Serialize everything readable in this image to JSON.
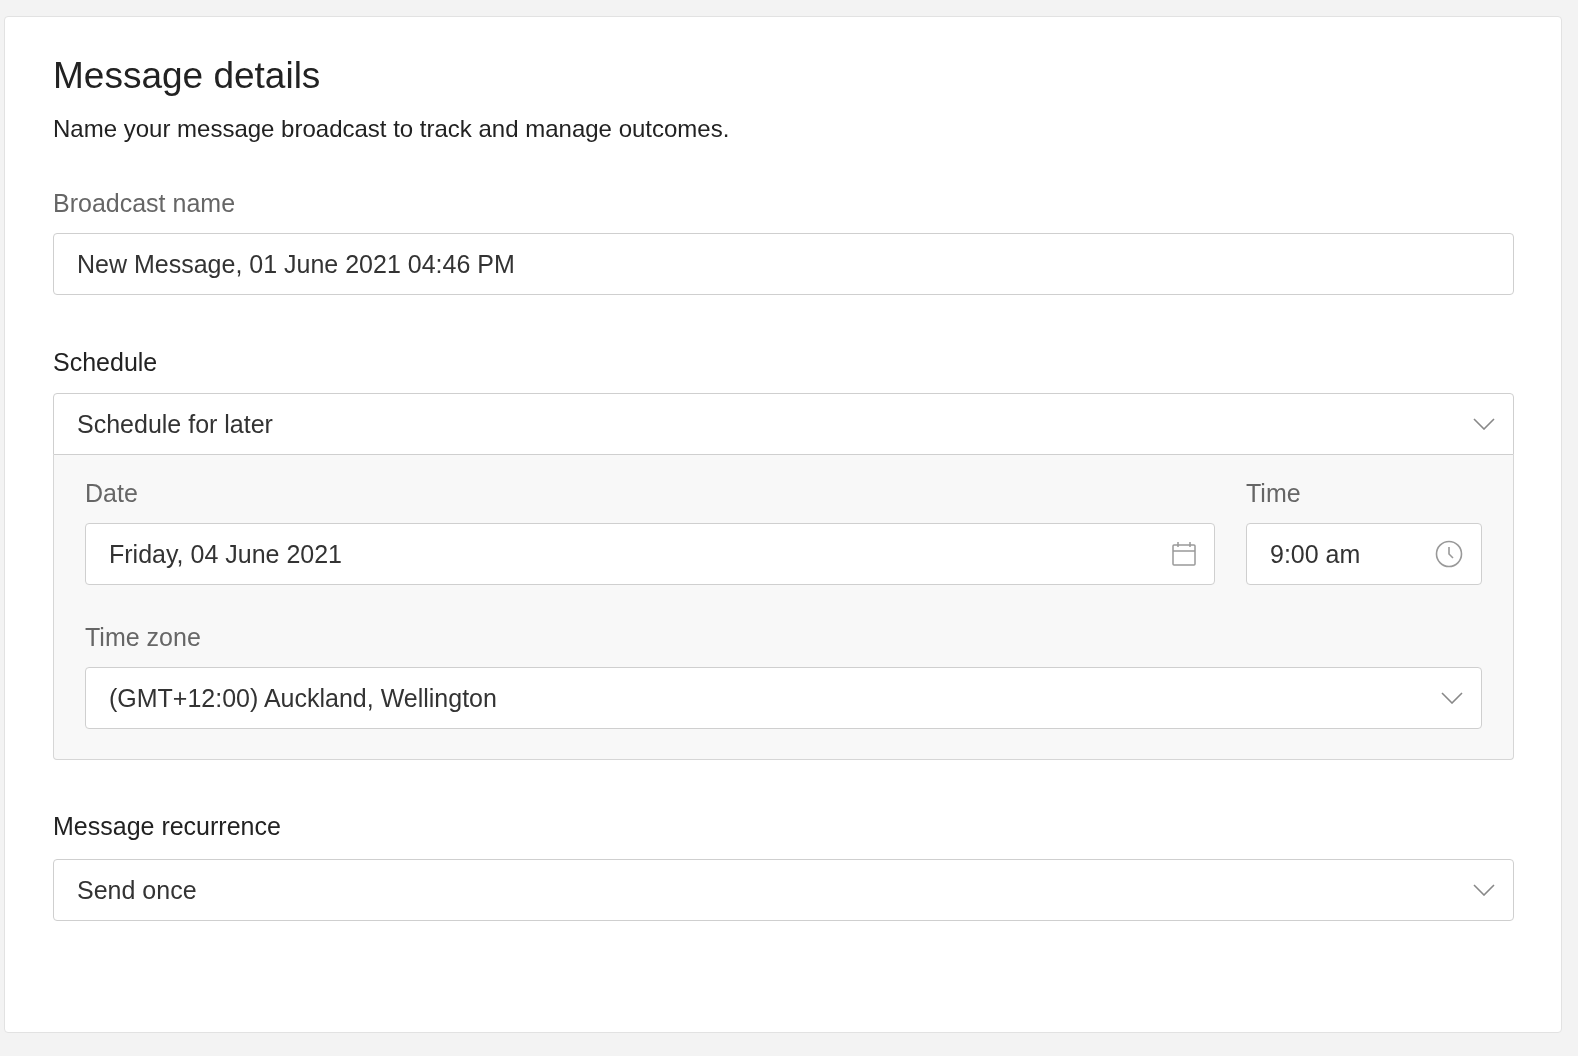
{
  "card": {
    "title": "Message details",
    "description": "Name your message broadcast to track and manage outcomes."
  },
  "broadcast_name": {
    "label": "Broadcast name",
    "value": "New Message, 01 June 2021 04:46 PM"
  },
  "schedule": {
    "label": "Schedule",
    "value": "Schedule for later",
    "expanded": true,
    "date": {
      "label": "Date",
      "value": "Friday, 04 June 2021"
    },
    "time": {
      "label": "Time",
      "value": "9:00 am"
    },
    "time_zone": {
      "label": "Time zone",
      "value": "(GMT+12:00) Auckland, Wellington"
    }
  },
  "recurrence": {
    "label": "Message recurrence",
    "value": "Send once"
  }
}
